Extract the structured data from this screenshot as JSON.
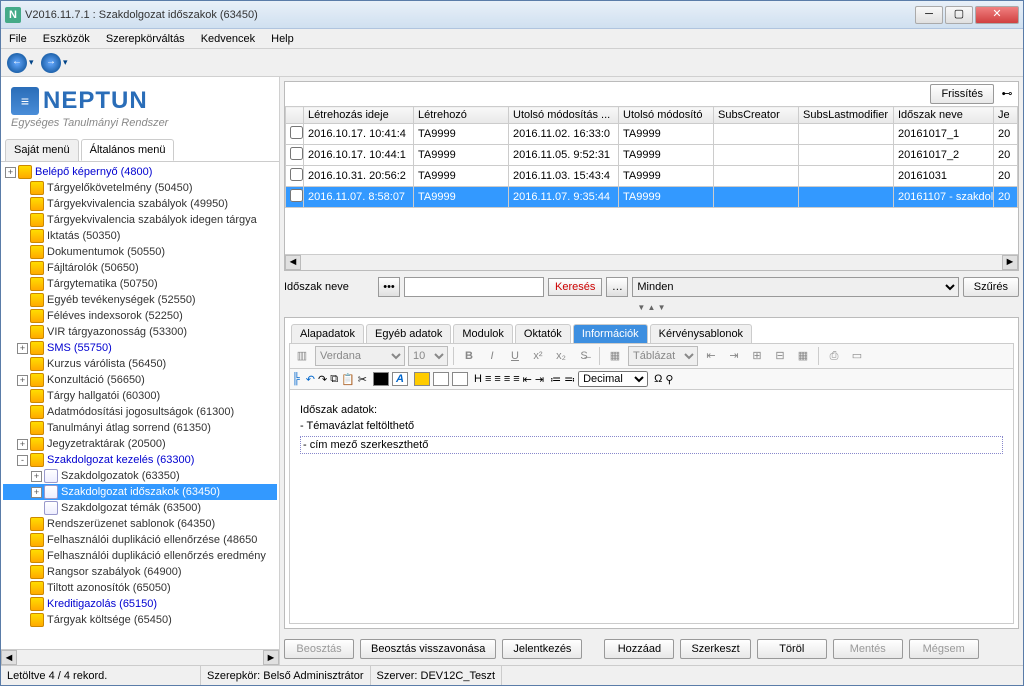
{
  "window": {
    "title": "V2016.11.7.1 : Szakdolgozat időszakok (63450)"
  },
  "menu": {
    "file": "File",
    "tools": "Eszközök",
    "role": "Szerepkörváltás",
    "fav": "Kedvencek",
    "help": "Help"
  },
  "logo": {
    "name": "NEPTUN",
    "slogan": "Egységes Tanulmányi Rendszer"
  },
  "panel_tabs": {
    "own": "Saját menü",
    "general": "Általános menü"
  },
  "tree": [
    {
      "l": "Belépő képernyő (4800)",
      "blue": true,
      "exp": "+",
      "ind": 0
    },
    {
      "l": "Tárgyelőkövetelmény (50450)",
      "ind": 1
    },
    {
      "l": "Tárgyekvivalencia szabályok (49950)",
      "ind": 1
    },
    {
      "l": "Tárgyekvivalencia szabályok idegen tárgya",
      "ind": 1
    },
    {
      "l": "Iktatás (50350)",
      "ind": 1
    },
    {
      "l": "Dokumentumok (50550)",
      "ind": 1
    },
    {
      "l": "Fájltárolók (50650)",
      "ind": 1
    },
    {
      "l": "Tárgytematika (50750)",
      "ind": 1
    },
    {
      "l": "Egyéb tevékenységek (52550)",
      "ind": 1
    },
    {
      "l": "Féléves indexsorok (52250)",
      "ind": 1
    },
    {
      "l": "VIR tárgyazonosság (53300)",
      "ind": 1
    },
    {
      "l": "SMS (55750)",
      "blue": true,
      "exp": "+",
      "ind": 1
    },
    {
      "l": "Kurzus várólista (56450)",
      "ind": 1
    },
    {
      "l": "Konzultáció (56650)",
      "exp": "+",
      "ind": 1
    },
    {
      "l": "Tárgy hallgatói (60300)",
      "ind": 1
    },
    {
      "l": "Adatmódosítási jogosultságok (61300)",
      "ind": 1
    },
    {
      "l": "Tanulmányi átlag sorrend (61350)",
      "ind": 1
    },
    {
      "l": "Jegyzetraktárak (20500)",
      "exp": "+",
      "ind": 1
    },
    {
      "l": "Szakdolgozat kezelés (63300)",
      "blue": true,
      "exp": "-",
      "ind": 1
    },
    {
      "l": "Szakdolgozatok (63350)",
      "exp": "+",
      "ind": 2,
      "doc": true
    },
    {
      "l": "Szakdolgozat időszakok (63450)",
      "exp": "+",
      "ind": 2,
      "sel": true,
      "doc": true
    },
    {
      "l": "Szakdolgozat témák (63500)",
      "ind": 2,
      "doc": true
    },
    {
      "l": "Rendszerüzenet sablonok (64350)",
      "ind": 1
    },
    {
      "l": "Felhasználói duplikáció ellenőrzése  (48650",
      "ind": 1
    },
    {
      "l": "Felhasználói duplikáció ellenőrzés eredmény",
      "ind": 1
    },
    {
      "l": "Rangsor szabályok (64900)",
      "ind": 1
    },
    {
      "l": "Tiltott azonosítók (65050)",
      "ind": 1
    },
    {
      "l": "Kreditigazolás (65150)",
      "blue": true,
      "ind": 1
    },
    {
      "l": "Tárgyak költsége (65450)",
      "ind": 1
    }
  ],
  "grid": {
    "refresh": "Frissítés",
    "headers": [
      "",
      "Létrehozás ideje",
      "Létrehozó",
      "Utolsó módosítás ...",
      "Utolsó módosító",
      "SubsCreator",
      "SubsLastmodifier",
      "Időszak neve",
      "Je"
    ],
    "rows": [
      {
        "c": [
          "",
          "2016.10.17. 10:41:4",
          "TA9999",
          "2016.11.02. 16:33:0",
          "TA9999",
          "",
          "",
          "20161017_1",
          "20"
        ]
      },
      {
        "c": [
          "",
          "2016.10.17. 10:44:1",
          "TA9999",
          "2016.11.05. 9:52:31",
          "TA9999",
          "",
          "",
          "20161017_2",
          "20"
        ]
      },
      {
        "c": [
          "",
          "2016.10.31. 20:56:2",
          "TA9999",
          "2016.11.03. 15:43:4",
          "TA9999",
          "",
          "",
          "20161031",
          "20"
        ]
      },
      {
        "c": [
          "",
          "2016.11.07. 8:58:07",
          "TA9999",
          "2016.11.07. 9:35:44",
          "TA9999",
          "",
          "",
          "20161107 - szakdol",
          "20"
        ],
        "sel": true
      }
    ]
  },
  "search": {
    "label": "Időszak neve",
    "btn": "Keresés",
    "all": "Minden",
    "filter": "Szűrés"
  },
  "detail_tabs": {
    "a": "Alapadatok",
    "b": "Egyéb adatok",
    "c": "Modulok",
    "d": "Oktatók",
    "e": "Információk",
    "f": "Kérvénysablonok"
  },
  "editor": {
    "font": "Verdana",
    "size": "10",
    "table": "Táblázat",
    "decimal": "Decimal"
  },
  "content": {
    "h": "Időszak adatok:",
    "l1": "- Témavázlat feltölthető",
    "l2": "- cím mező szerkeszthető"
  },
  "buttons": {
    "b1": "Beosztás",
    "b2": "Beosztás visszavonása",
    "b3": "Jelentkezés",
    "add": "Hozzáad",
    "edit": "Szerkeszt",
    "del": "Töröl",
    "save": "Mentés",
    "cancel": "Mégsem"
  },
  "status": {
    "records": "Letöltve 4 / 4 rekord.",
    "role": "Szerepkör: Belső Adminisztrátor",
    "server": "Szerver: DEV12C_Teszt"
  }
}
